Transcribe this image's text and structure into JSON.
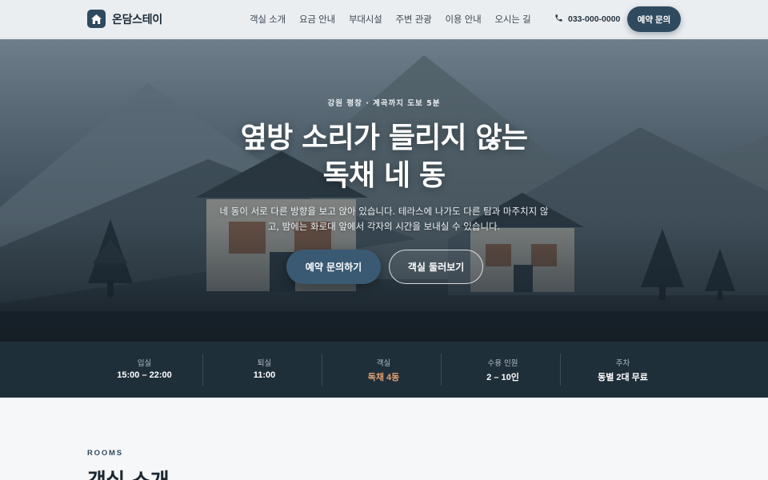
{
  "header": {
    "logo_text": "온담스테이",
    "nav": [
      "객실 소개",
      "요금 안내",
      "부대시설",
      "주변 관광",
      "이용 안내",
      "오시는 길"
    ],
    "phone": "033-000-0000",
    "cta_label": "예약 문의"
  },
  "hero": {
    "eyebrow": "강원 평창 · 계곡까지 도보 5분",
    "title_line1": "옆방 소리가 들리지 않는",
    "title_line2": "독채 네 동",
    "description": "네 동이 서로 다른 방향을 보고 앉아 있습니다. 테라스에 나가도 다른 팀과 마주치지 않고, 밤에는 화로대 앞에서 각자의 시간을 보내실 수 있습니다.",
    "primary_button": "예약 문의하기",
    "secondary_button": "객실 둘러보기"
  },
  "info": [
    {
      "label": "입실",
      "value": "15:00 – 22:00"
    },
    {
      "label": "퇴실",
      "value": "11:00"
    },
    {
      "label": "객실",
      "value": "독채 4동"
    },
    {
      "label": "수용 인원",
      "value": "2 – 10인"
    },
    {
      "label": "주차",
      "value": "동별 2대 무료"
    }
  ],
  "rooms": {
    "eyebrow": "ROOMS",
    "title": "객실 소개"
  },
  "colors": {
    "brand": "#2f4a5e",
    "infobar_bg": "#1f2f3a",
    "accent": "#e2a070"
  },
  "icons": {
    "logo": "house-icon",
    "phone": "phone-icon"
  }
}
